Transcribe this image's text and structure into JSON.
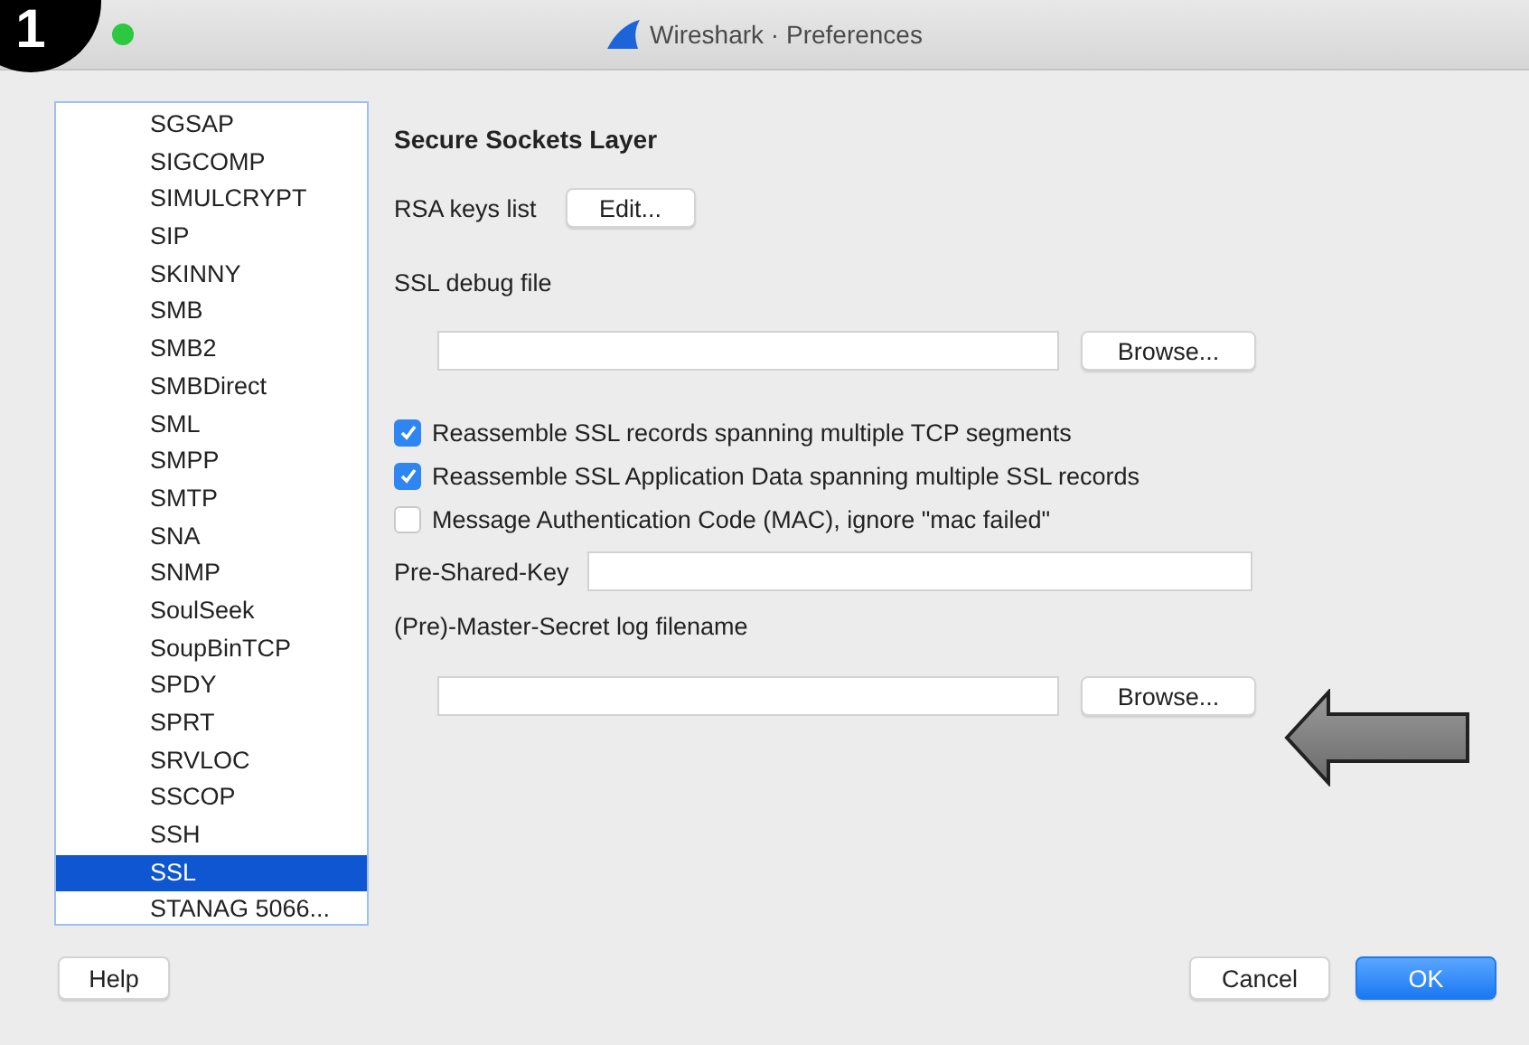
{
  "step_badge": "1",
  "window": {
    "title": "Wireshark · Preferences"
  },
  "protocols": [
    {
      "label": "SGSAP",
      "selected": false
    },
    {
      "label": "SIGCOMP",
      "selected": false
    },
    {
      "label": "SIMULCRYPT",
      "selected": false
    },
    {
      "label": "SIP",
      "selected": false
    },
    {
      "label": "SKINNY",
      "selected": false
    },
    {
      "label": "SMB",
      "selected": false
    },
    {
      "label": "SMB2",
      "selected": false
    },
    {
      "label": "SMBDirect",
      "selected": false
    },
    {
      "label": "SML",
      "selected": false
    },
    {
      "label": "SMPP",
      "selected": false
    },
    {
      "label": "SMTP",
      "selected": false
    },
    {
      "label": "SNA",
      "selected": false
    },
    {
      "label": "SNMP",
      "selected": false
    },
    {
      "label": "SoulSeek",
      "selected": false
    },
    {
      "label": "SoupBinTCP",
      "selected": false
    },
    {
      "label": "SPDY",
      "selected": false
    },
    {
      "label": "SPRT",
      "selected": false
    },
    {
      "label": "SRVLOC",
      "selected": false
    },
    {
      "label": "SSCOP",
      "selected": false
    },
    {
      "label": "SSH",
      "selected": false
    },
    {
      "label": "SSL",
      "selected": true
    },
    {
      "label": "STANAG 5066...",
      "selected": false
    }
  ],
  "panel": {
    "heading": "Secure Sockets Layer",
    "rsa_label": "RSA keys list",
    "rsa_button": "Edit...",
    "debug_label": "SSL debug file",
    "debug_browse": "Browse...",
    "checkboxes": [
      {
        "label": "Reassemble SSL records spanning multiple TCP segments",
        "checked": true
      },
      {
        "label": "Reassemble SSL Application Data spanning multiple SSL records",
        "checked": true
      },
      {
        "label": "Message Authentication Code (MAC), ignore \"mac failed\"",
        "checked": false
      }
    ],
    "psk_label": "Pre-Shared-Key",
    "log_label": "(Pre)-Master-Secret log filename",
    "log_browse": "Browse..."
  },
  "buttons": {
    "help": "Help",
    "cancel": "Cancel",
    "ok": "OK"
  }
}
